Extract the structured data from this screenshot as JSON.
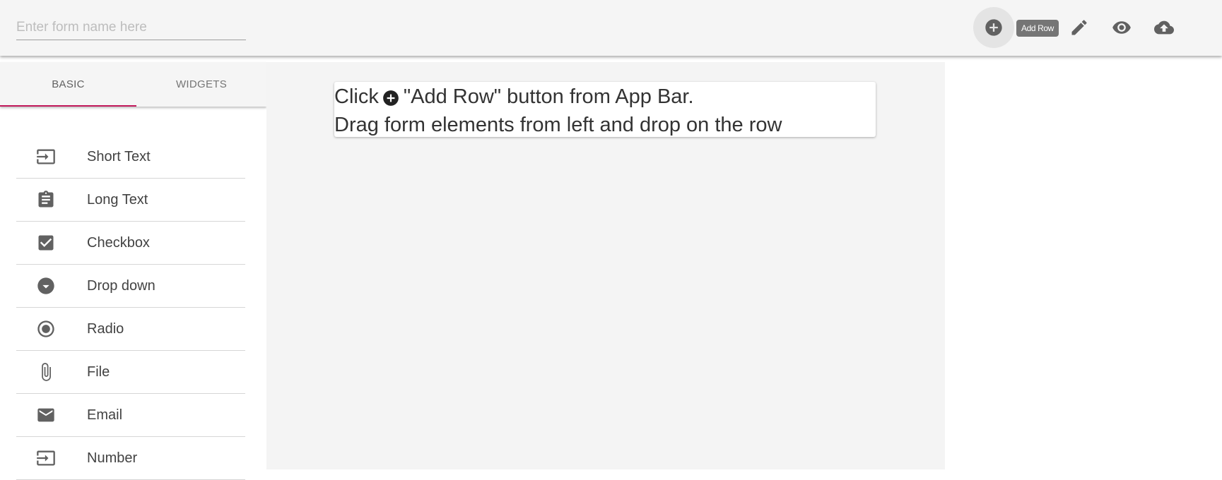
{
  "appbar": {
    "form_name_placeholder": "Enter form name here",
    "form_name_value": "",
    "add_row_tooltip": "Add Row",
    "buttons": [
      "add-circle-icon",
      "pencil-icon",
      "eye-icon",
      "cloud-upload-icon"
    ]
  },
  "sidebar": {
    "tabs": [
      {
        "label": "BASIC",
        "active": true
      },
      {
        "label": "WIDGETS",
        "active": false
      }
    ],
    "active_tab_color": "#c2185b",
    "items": [
      {
        "label": "Short Text",
        "icon": "input-icon"
      },
      {
        "label": "Long Text",
        "icon": "clipboard-icon"
      },
      {
        "label": "Checkbox",
        "icon": "checkbox-icon"
      },
      {
        "label": "Drop down",
        "icon": "dropdown-circle-icon"
      },
      {
        "label": "Radio",
        "icon": "radio-icon"
      },
      {
        "label": "File",
        "icon": "paperclip-icon"
      },
      {
        "label": "Email",
        "icon": "mail-icon"
      },
      {
        "label": "Number",
        "icon": "input-icon"
      }
    ]
  },
  "canvas": {
    "hint": {
      "click": "Click",
      "add_row": "\"Add Row\" button from App Bar.",
      "line2": "Drag form elements from left and drop on the row"
    }
  }
}
